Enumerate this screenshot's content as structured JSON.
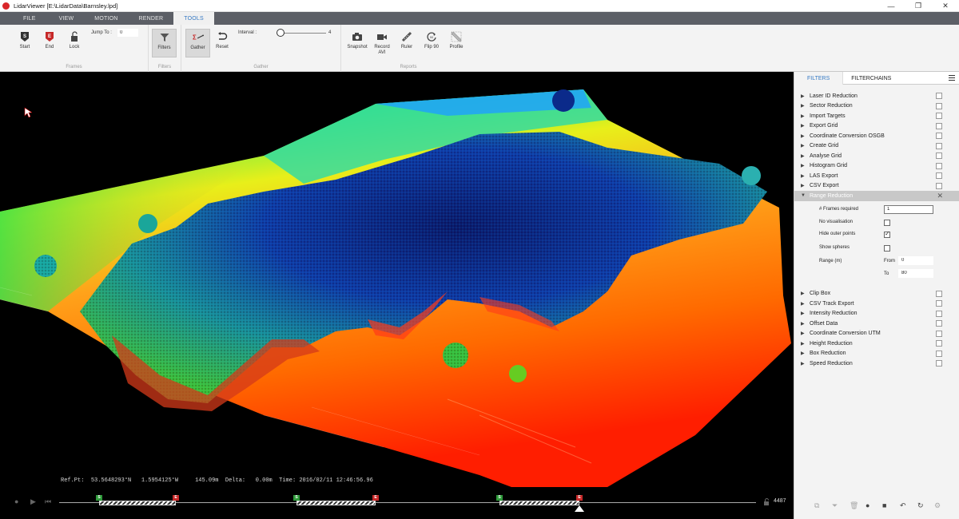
{
  "window": {
    "title": "LidarViewer [E:\\LidarData\\Barnsley.lpd]",
    "minimize": "—",
    "maximize": "❐",
    "close": "✕"
  },
  "menu": {
    "tabs": [
      "FILE",
      "VIEW",
      "MOTION",
      "RENDER",
      "TOOLS"
    ],
    "active": "TOOLS"
  },
  "ribbon": {
    "frames": {
      "label": "Frames",
      "start": "Start",
      "end": "End",
      "lock": "Lock",
      "jump_to_label": "Jump To :",
      "jump_to_value": "0"
    },
    "filters": {
      "label": "Filters",
      "filters_btn": "Filters"
    },
    "gather": {
      "label": "Gather",
      "gather_btn": "Gather",
      "reset_btn": "Reset",
      "interval_label": "Interval :",
      "interval_value": "4"
    },
    "reports": {
      "label": "Reports",
      "snapshot": "Snapshot",
      "record_avi_1": "Record",
      "record_avi_2": "AVI",
      "ruler": "Ruler",
      "flip90": "Flip 90",
      "profile": "Profile"
    }
  },
  "viewport": {
    "status": {
      "ref_label": "Ref.Pt:",
      "lat": "53.5648293°N",
      "lon": "1.5954125°W",
      "alt": "145.09m",
      "delta_label": "Delta:",
      "delta": "0.00m",
      "time_label": "Time:",
      "time": "2016/02/11 12:46:56.96"
    },
    "timeline": {
      "start_marker": "S",
      "end_marker": "E",
      "frame_count": "4487"
    }
  },
  "panel": {
    "tabs": [
      "FILTERS",
      "FILTERCHAINS"
    ],
    "filters_top": [
      "Laser ID Reduction",
      "Sector Reduction",
      "Import Targets",
      "Export Grid",
      "Coordinate Conversion OSGB",
      "Create Grid",
      "Analyse Grid",
      "Histogram Grid",
      "LAS Export",
      "CSV Export"
    ],
    "selected_filter": "Range Reduction",
    "options": {
      "frames_required_label": "# Frames required",
      "frames_required_value": "1",
      "no_visualisation_label": "No visualisation",
      "hide_outer_points_label": "Hide outer points",
      "show_spheres_label": "Show spheres",
      "range_label": "Range (m)",
      "from_label": "From",
      "from_value": "0",
      "to_label": "To",
      "to_value": "80"
    },
    "filters_bottom": [
      "Clip Box",
      "CSV Track Export",
      "Intensity Reduction",
      "Offset Data",
      "Coordinate Conversion UTM",
      "Height Reduction",
      "Box Reduction",
      "Speed Reduction"
    ]
  },
  "colors": {
    "accent": "#3579c4",
    "menubar": "#5c5f66",
    "viewport_bg": "#000000",
    "start_marker": "#2e9a3a",
    "end_marker": "#c62828"
  }
}
